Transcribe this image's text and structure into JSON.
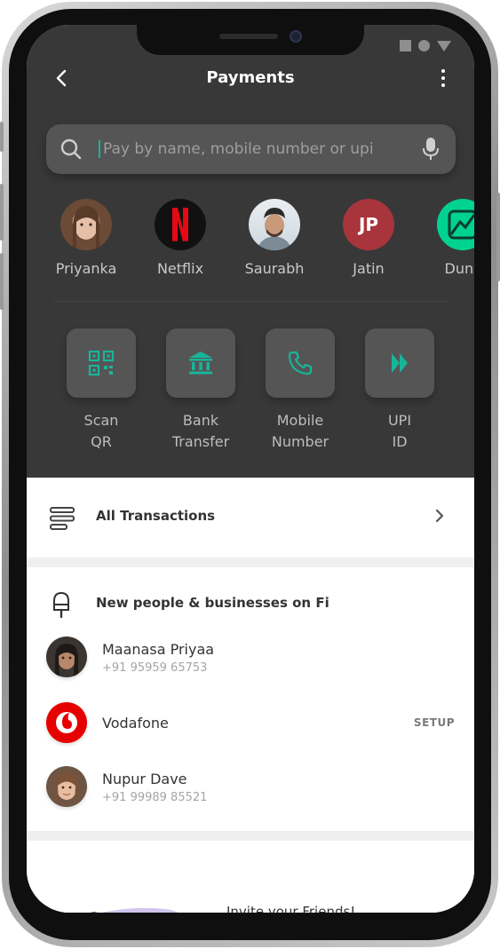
{
  "header": {
    "title": "Payments"
  },
  "search": {
    "placeholder": "Pay by name, mobile number or upi"
  },
  "contacts": [
    {
      "name": "Priyanka"
    },
    {
      "name": "Netflix",
      "logo_letter": "N"
    },
    {
      "name": "Saurabh"
    },
    {
      "name": "Jatin",
      "initials": "JP"
    },
    {
      "name": "Dunz"
    }
  ],
  "actions": [
    {
      "line1": "Scan",
      "line2": "QR",
      "icon": "qr-code-icon"
    },
    {
      "line1": "Bank",
      "line2": "Transfer",
      "icon": "bank-icon"
    },
    {
      "line1": "Mobile",
      "line2": "Number",
      "icon": "phone-icon"
    },
    {
      "line1": "UPI",
      "line2": "ID",
      "icon": "upi-icon"
    }
  ],
  "all_transactions": {
    "label": "All Transactions"
  },
  "new_people": {
    "title": "New people & businesses on Fi",
    "people": [
      {
        "name": "Maanasa Priyaa",
        "phone": "+91 95959 65753"
      },
      {
        "name": "Vodafone",
        "action": "SETUP"
      },
      {
        "name": "Nupur Dave",
        "phone": "+91 99989 85521"
      }
    ]
  },
  "invite": {
    "text": "Invite your Friends!"
  },
  "colors": {
    "accent": "#18b59a",
    "dark_bg": "#383838",
    "tile_bg": "#555555",
    "jatin_avatar": "#a8343c",
    "netflix_red": "#e50914",
    "vodafone_red": "#e60000"
  }
}
